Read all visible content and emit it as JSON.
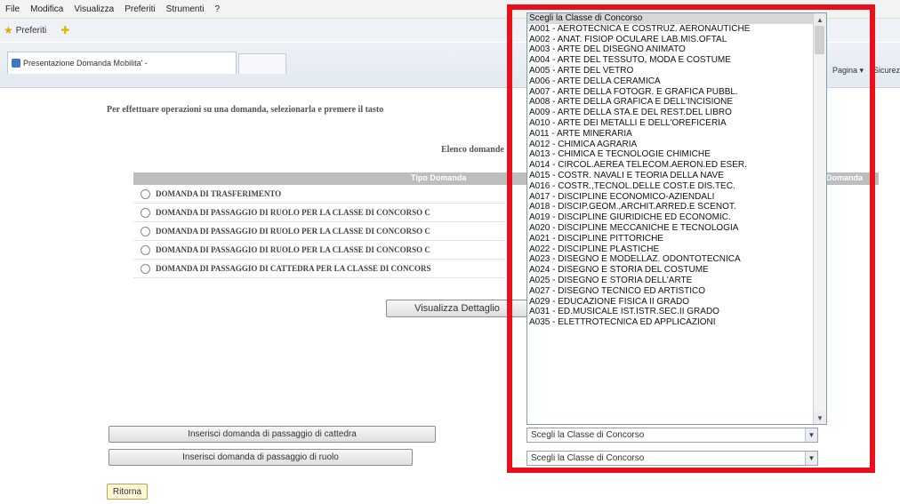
{
  "menu": [
    "File",
    "Modifica",
    "Visualizza",
    "Preferiti",
    "Strumenti",
    "?"
  ],
  "favorites": {
    "label": "Preferiti"
  },
  "tab": {
    "title": "Presentazione Domanda Mobilita' -"
  },
  "toolbar_right": {
    "pagina": "Pagina ▾",
    "sicurezza": "Sicurez"
  },
  "page": {
    "instruction": "Per effettuare operazioni su una domanda, selezionarla e premere il tasto",
    "list_title": "Elenco domande",
    "table": {
      "headers": [
        "Tipo Domanda",
        "Domanda"
      ],
      "rows": [
        "DOMANDA DI TRASFERIMENTO",
        "DOMANDA DI PASSAGGIO DI RUOLO PER LA CLASSE DI CONCORSO C",
        "DOMANDA DI PASSAGGIO DI RUOLO PER LA CLASSE DI CONCORSO C",
        "DOMANDA DI PASSAGGIO DI RUOLO PER LA CLASSE DI CONCORSO C",
        "DOMANDA DI PASSAGGIO DI CATTEDRA PER LA CLASSE DI CONCORS"
      ]
    },
    "details_button": "Visualizza Dettaglio",
    "insert_cattedra_button": "Inserisci domanda di passaggio di cattedra",
    "insert_ruolo_button": "Inserisci domanda di passaggio di ruolo",
    "back_button": "Ritorna"
  },
  "select": {
    "placeholder": "Scegli la Classe di Concorso",
    "options": [
      "Scegli la Classe di Concorso",
      "A001 - AEROTECNICA E COSTRUZ. AERONAUTICHE",
      "A002 - ANAT. FISIOP OCULARE LAB.MIS.OFTAL",
      "A003 - ARTE DEL DISEGNO ANIMATO",
      "A004 - ARTE DEL TESSUTO, MODA E COSTUME",
      "A005 - ARTE DEL VETRO",
      "A006 - ARTE DELLA CERAMICA",
      "A007 - ARTE DELLA FOTOGR. E GRAFICA PUBBL.",
      "A008 - ARTE DELLA GRAFICA E DELL'INCISIONE",
      "A009 - ARTE DELLA STA.E DEL REST.DEL LIBRO",
      "A010 - ARTE DEI METALLI E DELL'OREFICERIA",
      "A011 - ARTE MINERARIA",
      "A012 - CHIMICA AGRARIA",
      "A013 - CHIMICA E TECNOLOGIE CHIMICHE",
      "A014 - CIRCOL.AEREA TELECOM.AERON.ED ESER.",
      "A015 - COSTR. NAVALI E TEORIA DELLA NAVE",
      "A016 - COSTR.,TECNOL.DELLE COST.E DIS.TEC.",
      "A017 - DISCIPLINE ECONOMICO-AZIENDALI",
      "A018 - DISCIP.GEOM.,ARCHIT.ARRED.E SCENOT.",
      "A019 - DISCIPLINE GIURIDICHE ED ECONOMIC.",
      "A020 - DISCIPLINE MECCANICHE E TECNOLOGIA",
      "A021 - DISCIPLINE PITTORICHE",
      "A022 - DISCIPLINE PLASTICHE",
      "A023 - DISEGNO E MODELLAZ. ODONTOTECNICA",
      "A024 - DISEGNO E STORIA DEL COSTUME",
      "A025 - DISEGNO E STORIA DELL'ARTE",
      "A027 - DISEGNO TECNICO ED ARTISTICO",
      "A029 - EDUCAZIONE FISICA II GRADO",
      "A031 - ED.MUSICALE IST.ISTR.SEC.II GRADO",
      "A035 - ELETTROTECNICA ED APPLICAZIONI"
    ],
    "second_select_value": "Scegli la Classe di Concorso"
  },
  "colors": {
    "highlight": "#e8101a",
    "table_header": "#bdbdbd"
  },
  "icons": [
    "favorites-star-icon",
    "add-favorite-icon",
    "page-icon",
    "scroll-up-icon",
    "scroll-down-icon",
    "dropdown-arrow-icon"
  ]
}
